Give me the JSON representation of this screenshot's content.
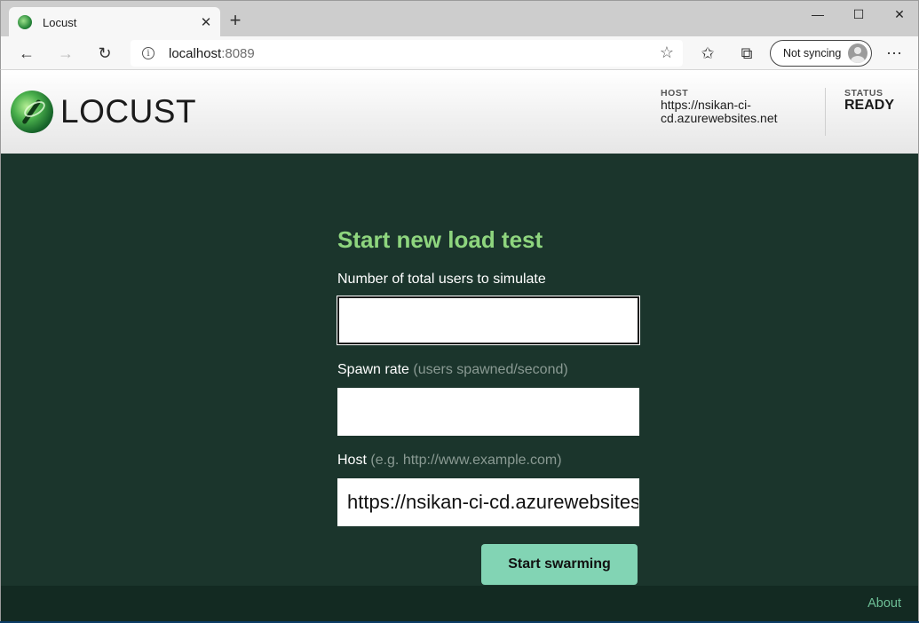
{
  "browser": {
    "tab_title": "Locust",
    "tab_close": "✕",
    "new_tab": "+",
    "window_controls": {
      "minimize": "—",
      "maximize": "☐",
      "close": "✕"
    },
    "nav": {
      "back": "←",
      "forward": "→",
      "refresh": "↻"
    },
    "url_host": "localhost",
    "url_port": ":8089",
    "info_icon": "i",
    "favorite_icon": "☆",
    "favorites_icon": "✩",
    "collections_icon": "⧉",
    "sync_label": "Not syncing",
    "more_icon": "⋯"
  },
  "header": {
    "logo_text": "LOCUST",
    "host_label": "HOST",
    "host_value": "https://nsikan-ci-cd.azurewebsites.net",
    "status_label": "STATUS",
    "status_value": "READY"
  },
  "form": {
    "title": "Start new load test",
    "users_label": "Number of total users to simulate",
    "users_value": "",
    "spawn_label": "Spawn rate",
    "spawn_hint": "(users spawned/second)",
    "spawn_value": "",
    "host_label": "Host",
    "host_hint": "(e.g. http://www.example.com)",
    "host_value": "https://nsikan-ci-cd.azurewebsites.net",
    "submit_label": "Start swarming"
  },
  "footer": {
    "about_label": "About"
  },
  "colors": {
    "main_bg": "#1b352c",
    "footer_bg": "#132a22",
    "title_green": "#8ed57e",
    "button_bg": "#82d4b4",
    "about_link": "#6dbf96"
  }
}
